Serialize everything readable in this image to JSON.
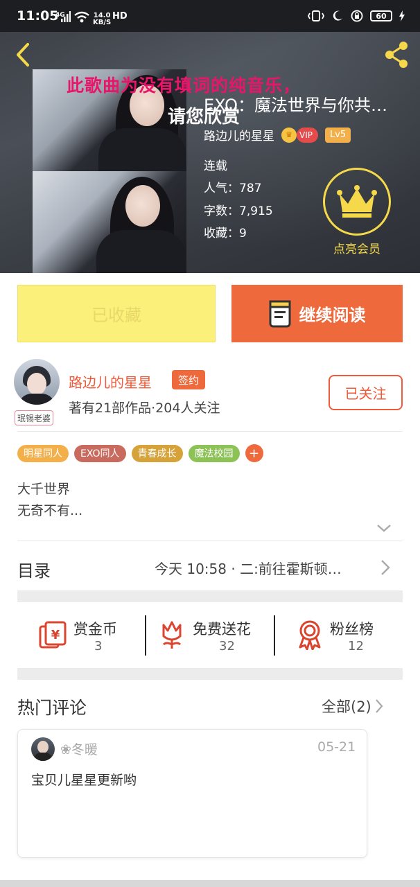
{
  "status_bar": {
    "time": "11:05",
    "network": "4G",
    "speed_value": "14.0",
    "speed_unit": "KB/S",
    "hd": "HD",
    "battery": "60"
  },
  "hero": {
    "marquee_line1": "此歌曲为没有填词的纯音乐，",
    "marquee_line2": "请您欣赏",
    "book_title": "EXO：魔法世界与你共…",
    "author_name": "路边儿的星星",
    "vip_label": "VIP",
    "level_label": "Lv5",
    "status": "连载",
    "popularity_label": "人气",
    "popularity_value": "787",
    "word_count_label": "字数",
    "word_count_value": "7,915",
    "favorites_label": "收藏",
    "favorites_value": "9",
    "vip_member_label": "点亮会员"
  },
  "actions": {
    "collected_label": "已收藏",
    "continue_reading_label": "继续阅读"
  },
  "author": {
    "name": "路边儿的星星",
    "sign_badge": "签约",
    "stats": "著有21部作品·204人关注",
    "follow_label": "已关注",
    "avatar_tag": "珉锡老婆"
  },
  "tags": [
    {
      "label": "明星同人",
      "color": "#f3b04a"
    },
    {
      "label": "EXO同人",
      "color": "#c86a5e"
    },
    {
      "label": "青春成长",
      "color": "#d6a23a"
    },
    {
      "label": "魔法校园",
      "color": "#8cc256"
    }
  ],
  "tag_add_label": "+",
  "description": {
    "line1": "大千世界",
    "line2": "无奇不有..."
  },
  "toc": {
    "label": "目录",
    "latest": "今天 10:58 · 二:前往霍斯顿…"
  },
  "stats": [
    {
      "label": "赏金币",
      "value": "3",
      "icon": "reward-coin-icon"
    },
    {
      "label": "免费送花",
      "value": "32",
      "icon": "flower-icon"
    },
    {
      "label": "粉丝榜",
      "value": "12",
      "icon": "medal-icon"
    }
  ],
  "comments": {
    "title": "热门评论",
    "all_label": "全部(2)",
    "items": [
      {
        "user": "❀冬暖",
        "date": "05-21",
        "text": "宝贝儿星星更新哟"
      }
    ]
  },
  "colors": {
    "accent": "#ee6a3d",
    "author_red": "#ee5a3a",
    "collected_yellow": "#fbf07a",
    "vip_gold": "#f6d94a"
  }
}
